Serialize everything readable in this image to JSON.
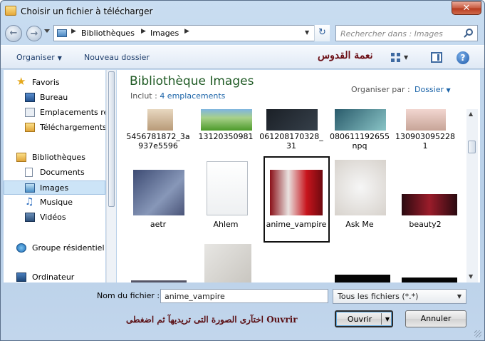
{
  "window": {
    "title": "Choisir un fichier à télécharger",
    "close_label": "✕"
  },
  "nav": {
    "breadcrumbs": [
      "Bibliothèques",
      "Images"
    ],
    "search_placeholder": "Rechercher dans : Images"
  },
  "toolbar": {
    "organize_label": "Organiser",
    "new_folder_label": "Nouveau dossier",
    "arabic_name": "نعمة القدوس",
    "help_label": "?"
  },
  "sidebar": {
    "items": [
      {
        "label": "Favoris",
        "icon": "star-icon"
      },
      {
        "label": "Bureau",
        "icon": "desktop-icon"
      },
      {
        "label": "Emplacements ré",
        "icon": "recent-places-icon"
      },
      {
        "label": "Téléchargements",
        "icon": "downloads-icon"
      },
      {
        "label": "Bibliothèques",
        "icon": "libraries-icon"
      },
      {
        "label": "Documents",
        "icon": "documents-icon"
      },
      {
        "label": "Images",
        "icon": "pictures-icon",
        "selected": true
      },
      {
        "label": "Musique",
        "icon": "music-icon"
      },
      {
        "label": "Vidéos",
        "icon": "videos-icon"
      },
      {
        "label": "Groupe résidentiel",
        "icon": "homegroup-icon"
      },
      {
        "label": "Ordinateur",
        "icon": "computer-icon"
      }
    ]
  },
  "content": {
    "title": "Bibliothèque Images",
    "include_label": "Inclut :",
    "include_link": "4 emplacements",
    "arrange_label": "Organiser par :",
    "arrange_value": "Dossier",
    "files_row1": [
      {
        "name": "5456781872_3a937e5596"
      },
      {
        "name": "13120350981"
      },
      {
        "name": "061208170328_31"
      },
      {
        "name": "080611192655npq"
      },
      {
        "name": "1309030952281"
      }
    ],
    "files_row2": [
      {
        "name": "aetr"
      },
      {
        "name": "Ahlem"
      },
      {
        "name": "anime_vampire",
        "selected": true
      },
      {
        "name": "Ask Me"
      },
      {
        "name": "beauty2"
      }
    ]
  },
  "bottom": {
    "filename_label": "Nom du fichier :",
    "filename_value": "anime_vampire",
    "filter_value": "Tous les fichiers (*.*)",
    "hint": "اختآرى الصورة التى تريديهآ ثم اضغطى  Ouvrir",
    "open_label": "Ouvrir",
    "cancel_label": "Annuler"
  }
}
